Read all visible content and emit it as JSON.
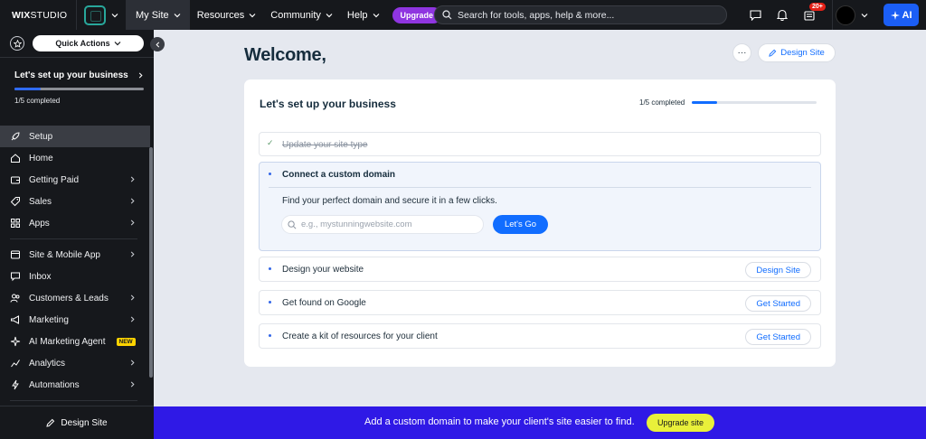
{
  "topbar": {
    "logo_bold": "WIX",
    "logo_light": "STUDIO",
    "nav": [
      {
        "label": "My Site"
      },
      {
        "label": "Resources"
      },
      {
        "label": "Community"
      },
      {
        "label": "Help"
      }
    ],
    "upgrade_label": "Upgrade",
    "search_placeholder": "Search for tools, apps, help & more...",
    "notifications_badge": "20+",
    "ai_label": "AI"
  },
  "sidebar": {
    "quick_actions_label": "Quick Actions",
    "setup_title": "Let's set up your business",
    "setup_progress_fraction": 0.2,
    "setup_progress_text": "1/5 completed",
    "menu": [
      {
        "label": "Setup",
        "icon": "rocket-icon",
        "arrow": false,
        "active": true
      },
      {
        "label": "Home",
        "icon": "home-icon",
        "arrow": false
      },
      {
        "label": "Getting Paid",
        "icon": "wallet-icon",
        "arrow": true
      },
      {
        "label": "Sales",
        "icon": "tag-icon",
        "arrow": true
      },
      {
        "label": "Apps",
        "icon": "grid-icon",
        "arrow": true
      },
      {
        "label": "Site & Mobile App",
        "icon": "window-icon",
        "arrow": true
      },
      {
        "label": "Inbox",
        "icon": "chat-icon",
        "arrow": false
      },
      {
        "label": "Customers & Leads",
        "icon": "people-icon",
        "arrow": true
      },
      {
        "label": "Marketing",
        "icon": "megaphone-icon",
        "arrow": true
      },
      {
        "label": "AI Marketing Agent",
        "icon": "sparkle-icon",
        "arrow": false,
        "badge": "NEW"
      },
      {
        "label": "Analytics",
        "icon": "chart-icon",
        "arrow": true
      },
      {
        "label": "Automations",
        "icon": "bolt-icon",
        "arrow": true
      }
    ],
    "bottom_label": "Design Site"
  },
  "main": {
    "welcome": "Welcome,",
    "more_label": "···",
    "design_site_label": "Design Site",
    "card": {
      "title": "Let's set up your business",
      "progress_text": "1/5 completed",
      "progress_fraction": 0.2,
      "steps": [
        {
          "label": "Update your site type",
          "state": "done"
        },
        {
          "label": "Connect a custom domain",
          "state": "open",
          "description": "Find your perfect domain and secure it in a few clicks.",
          "input_placeholder": "e.g., mystunningwebsite.com",
          "button": "Let's Go"
        },
        {
          "label": "Design your website",
          "button": "Design Site"
        },
        {
          "label": "Get found on Google",
          "button": "Get Started"
        },
        {
          "label": "Create a kit of resources for your client",
          "button": "Get Started"
        }
      ]
    }
  },
  "banner": {
    "text": "Add a custom domain to make your client's site easier to find.",
    "button": "Upgrade site"
  },
  "colors": {
    "accent": "#116dff",
    "banner_bg": "#2f19e6",
    "upgrade_purple": "#8f35e0",
    "banner_button": "#e9f03a",
    "sidebar_bg": "#16181c"
  }
}
